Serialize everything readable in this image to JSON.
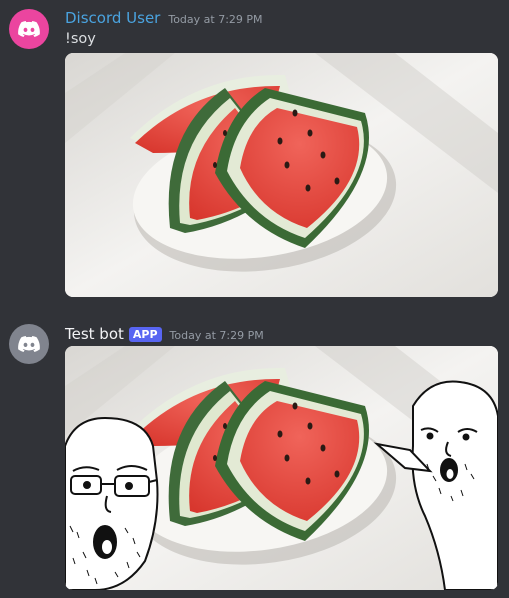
{
  "messages": [
    {
      "author": "Discord User",
      "timestamp": "Today at 7:29 PM",
      "text": "!soy",
      "avatar_icon": "discord-logo-icon",
      "avatar_color": "#eb459f",
      "name_color": "#4aa3df",
      "attachment": "watermelon-photo"
    },
    {
      "author": "Test bot",
      "badge": "APP",
      "timestamp": "Today at 7:29 PM",
      "avatar_icon": "discord-logo-icon",
      "avatar_color": "#80848e",
      "name_color": "#f2f3f5",
      "attachment": "watermelon-photo-with-soyjak-faces"
    }
  ],
  "colors": {
    "background": "#313338",
    "badge": "#5865f2",
    "timestamp": "#949ba4"
  }
}
